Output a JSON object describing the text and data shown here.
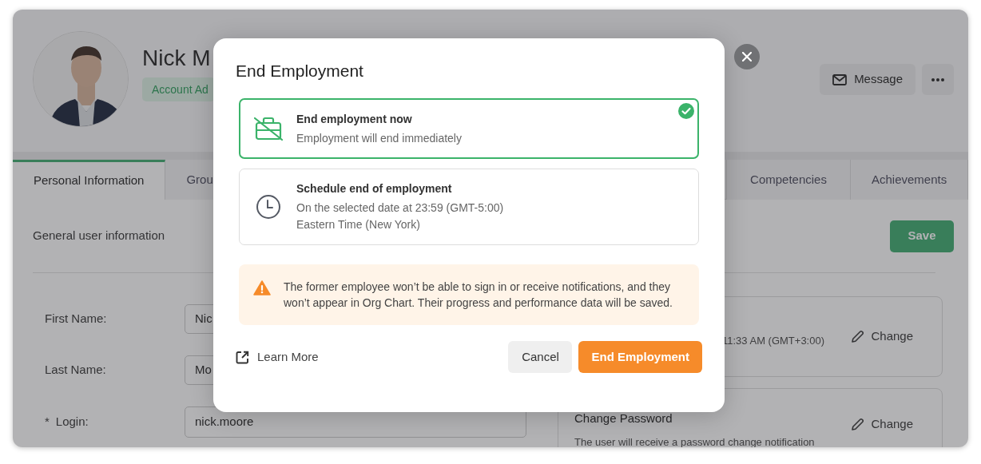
{
  "profile": {
    "name": "Nick M",
    "role_badge": "Account Ad",
    "message_button": "Message"
  },
  "tabs": [
    {
      "label": "Personal Information",
      "selected": true
    },
    {
      "label": "Grou",
      "selected": false
    },
    {
      "label": "Competencies",
      "selected": false
    },
    {
      "label": "Achievements",
      "selected": false
    }
  ],
  "section": {
    "title": "General user information",
    "save_button": "Save"
  },
  "fields": [
    {
      "label": "First Name:",
      "value": "Nic",
      "required": false
    },
    {
      "label": "Last Name:",
      "value": "Mo",
      "required": false
    },
    {
      "required_mark": "*",
      "label": "Login:",
      "value": "nick.moore",
      "required": true
    }
  ],
  "settings_panels": [
    {
      "detail": "11:33 AM (GMT+3:00)",
      "action": "Change"
    },
    {
      "title": "Change Password",
      "detail": "The user will receive a password change notification",
      "action": "Change"
    }
  ],
  "dialog": {
    "title": "End Employment",
    "options": [
      {
        "kind": "now",
        "title": "End employment now",
        "lines": [
          "Employment will end immediately"
        ],
        "selected": true
      },
      {
        "kind": "schedule",
        "title": "Schedule end of employment",
        "lines": [
          "On the selected date at 23:59 (GMT-5:00)",
          "Eastern Time (New York)"
        ],
        "selected": false
      }
    ],
    "warning": "The former employee won’t be able to sign in or receive notifications, and they won’t appear in Org Chart. Their progress and performance data will be saved.",
    "learn_more": "Learn More",
    "buttons": [
      {
        "kind": "secondary",
        "label": "Cancel"
      },
      {
        "kind": "primary",
        "label": "End Employment"
      }
    ]
  }
}
